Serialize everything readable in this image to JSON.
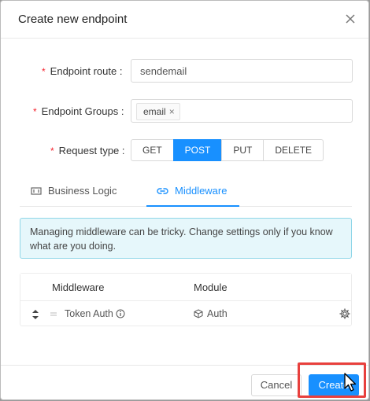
{
  "dialog": {
    "title": "Create new endpoint"
  },
  "form": {
    "route": {
      "required_mark": "*",
      "label": "Endpoint route :",
      "value": "sendemail"
    },
    "groups": {
      "required_mark": "*",
      "label": "Endpoint Groups :",
      "tags": [
        "email"
      ],
      "tag_remove": "×"
    },
    "request_type": {
      "required_mark": "*",
      "label": "Request type :",
      "options": [
        "GET",
        "POST",
        "PUT",
        "DELETE"
      ],
      "selected": "POST"
    }
  },
  "tabs": [
    {
      "label": "Business Logic",
      "icon": "code-brackets-icon",
      "active": false
    },
    {
      "label": "Middleware",
      "icon": "link-icon",
      "active": true
    }
  ],
  "alert": {
    "text": "Managing middleware can be tricky. Change settings only if you know what are you doing."
  },
  "middleware_table": {
    "columns": [
      "Middleware",
      "Module"
    ],
    "rows": [
      {
        "middleware": "Token Auth",
        "module": "Auth"
      }
    ]
  },
  "footer": {
    "cancel_label": "Cancel",
    "create_label": "Create"
  },
  "colors": {
    "primary": "#1890ff",
    "required": "#f5222d",
    "alert_bg": "#e6f7fb",
    "highlight": "#e8403d"
  }
}
